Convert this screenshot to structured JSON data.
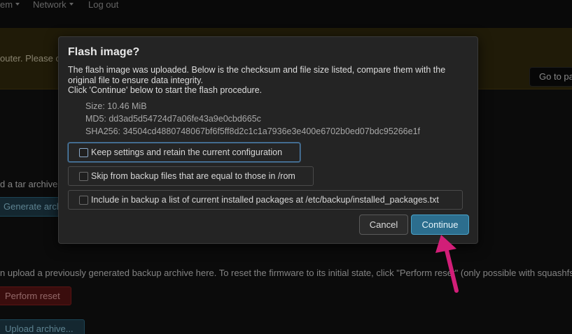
{
  "nav": {
    "system_label": "em",
    "network_label": "Network",
    "logout_label": "Log out"
  },
  "alert": {
    "text": "outer. Please c",
    "goto_button": "Go to pa"
  },
  "background": {
    "tar_text": "d a tar archive",
    "generate_button": "Generate arch",
    "upload_text": "n upload a previously generated backup archive here. To reset the firmware to its initial state, click \"Perform reset\" (only possible with squashfs",
    "perform_reset_button": "Perform reset",
    "upload_archive_button": "Upload archive..."
  },
  "modal": {
    "title": "Flash image?",
    "description_line1": "The flash image was uploaded. Below is the checksum and file size listed, compare them with the original file to ensure data integrity.",
    "description_line2": "Click 'Continue' below to start the flash procedure.",
    "size": "Size: 10.46 MiB",
    "md5": "MD5: dd3ad5d54724d7a06fe43a9e0cbd665c",
    "sha256": "SHA256: 34504cd4880748067bf6f5ff8d2c1c1a7936e3e400e6702b0ed07bdc95266e1f",
    "options": [
      {
        "label": "Keep settings and retain the current configuration",
        "checked": false,
        "focused": true
      },
      {
        "label": "Skip from backup files that are equal to those in /rom",
        "checked": false,
        "focused": false
      },
      {
        "label": "Include in backup a list of current installed packages at /etc/backup/installed_packages.txt",
        "checked": false,
        "focused": false
      }
    ],
    "cancel_label": "Cancel",
    "continue_label": "Continue"
  },
  "colors": {
    "accent": "#2c6e8e",
    "annotation_arrow": "#d21e78"
  }
}
